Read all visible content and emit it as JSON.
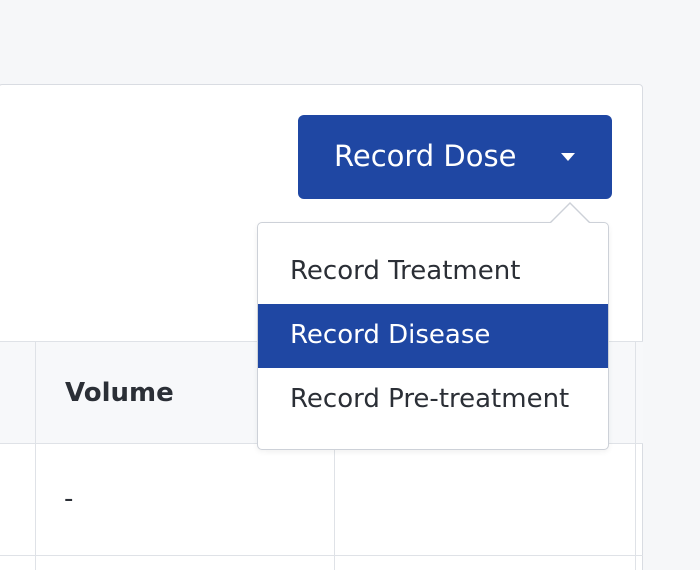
{
  "primary_button": {
    "label": "Record Dose",
    "icon": "caret-down-icon"
  },
  "dropdown_menu": {
    "items": [
      {
        "label": "Record Treatment",
        "active": false
      },
      {
        "label": "Record Disease",
        "active": true
      },
      {
        "label": "Record Pre-treatment",
        "active": false
      }
    ]
  },
  "table": {
    "columns": [
      "Volume"
    ],
    "rows": [
      {
        "volume": "-"
      }
    ]
  },
  "colors": {
    "accent": "#1f47a3",
    "page_background": "#f6f7f9",
    "border": "#dfe2e7",
    "text": "#2b2f36"
  }
}
